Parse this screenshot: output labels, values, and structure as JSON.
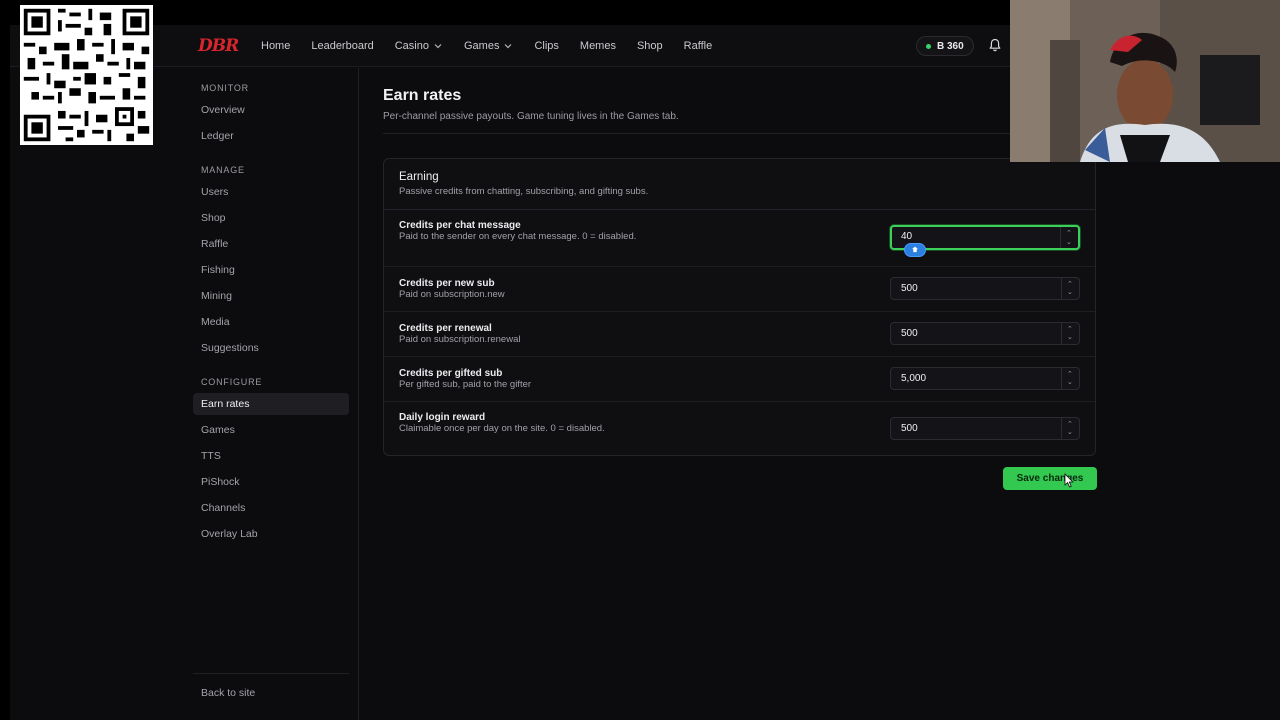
{
  "brand": {
    "logo_text": "DBR",
    "logo_color": "#d8252d"
  },
  "nav": {
    "items": [
      {
        "label": "Home",
        "has_menu": false
      },
      {
        "label": "Leaderboard",
        "has_menu": false
      },
      {
        "label": "Casino",
        "has_menu": true
      },
      {
        "label": "Games",
        "has_menu": true
      },
      {
        "label": "Clips",
        "has_menu": false
      },
      {
        "label": "Memes",
        "has_menu": false
      },
      {
        "label": "Shop",
        "has_menu": false
      },
      {
        "label": "Raffle",
        "has_menu": false
      }
    ],
    "balance": "B 360",
    "balance_status_color": "#38d36b"
  },
  "sidebar": {
    "sections": [
      {
        "heading": "MONITOR",
        "items": [
          "Overview",
          "Ledger"
        ]
      },
      {
        "heading": "MANAGE",
        "items": [
          "Users",
          "Shop",
          "Raffle",
          "Fishing",
          "Mining",
          "Media",
          "Suggestions"
        ]
      },
      {
        "heading": "CONFIGURE",
        "items": [
          "Earn rates",
          "Games",
          "TTS",
          "PiShock",
          "Channels",
          "Overlay Lab"
        ]
      }
    ],
    "active": "Earn rates",
    "back_link": "Back to site"
  },
  "page": {
    "title": "Earn rates",
    "subtitle": "Per-channel passive payouts. Game tuning lives in the Games tab."
  },
  "card": {
    "title": "Earning",
    "description": "Passive credits from chatting, subscribing, and gifting subs.",
    "rows": [
      {
        "label": "Credits per chat message",
        "help": "Paid to the sender on every chat message. 0 = disabled.",
        "value": "40",
        "focused": true
      },
      {
        "label": "Credits per new sub",
        "help": "Paid on subscription.new",
        "value": "500",
        "focused": false
      },
      {
        "label": "Credits per renewal",
        "help": "Paid on subscription.renewal",
        "value": "500",
        "focused": false
      },
      {
        "label": "Credits per gifted sub",
        "help": "Per gifted sub, paid to the gifter",
        "value": "5,000",
        "focused": false
      },
      {
        "label": "Daily login reward",
        "help": "Claimable once per day on the site. 0 = disabled.",
        "value": "500",
        "focused": false
      }
    ]
  },
  "actions": {
    "save_label": "Save changes",
    "save_color": "#33c84f"
  },
  "icons": {
    "bell": "bell-icon",
    "chevron": "chevron-down-icon",
    "spinner_up": "chevron-up-icon",
    "spinner_down": "chevron-down-icon",
    "cursor": "mouse-pointer-icon",
    "focus_badge": "shield-icon"
  }
}
